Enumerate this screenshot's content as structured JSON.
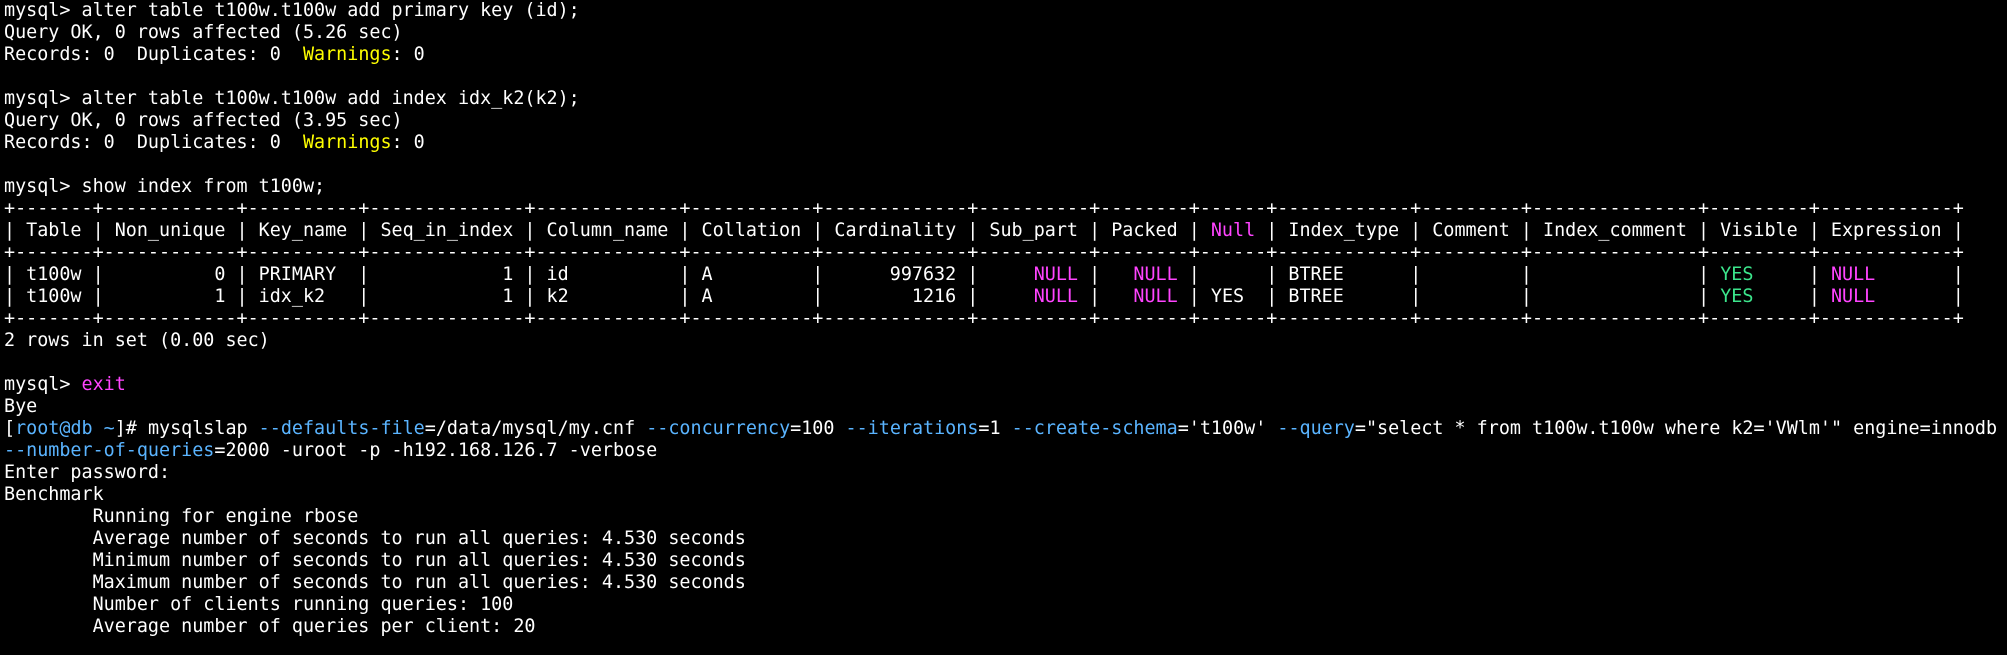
{
  "colors": {
    "background": "#000000",
    "text": "#ffffff",
    "yellow": "#ffff00",
    "magenta": "#ff44ff",
    "green": "#3ce68c",
    "cyan": "#5ab4ff"
  },
  "lines": [
    [
      {
        "t": "mysql> alter table t100w.t100w add primary key (id);"
      }
    ],
    [
      {
        "t": "Query OK, 0 rows affected (5.26 sec)"
      }
    ],
    [
      {
        "t": "Records: 0  Duplicates: 0  "
      },
      {
        "t": "Warnings",
        "c": "yellow"
      },
      {
        "t": ": 0"
      }
    ],
    [
      {
        "t": ""
      }
    ],
    [
      {
        "t": "mysql> alter table t100w.t100w add index idx_k2(k2);"
      }
    ],
    [
      {
        "t": "Query OK, 0 rows affected (3.95 sec)"
      }
    ],
    [
      {
        "t": "Records: 0  Duplicates: 0  "
      },
      {
        "t": "Warnings",
        "c": "yellow"
      },
      {
        "t": ": 0"
      }
    ],
    [
      {
        "t": ""
      }
    ],
    [
      {
        "t": "mysql> show index from t100w;"
      }
    ],
    [
      {
        "t": "+-------+------------+----------+--------------+-------------+-----------+-------------+----------+--------+------+------------+---------+---------------+---------+------------+"
      }
    ],
    [
      {
        "t": "| Table | Non_unique | Key_name | Seq_in_index | Column_name | Collation | Cardinality | Sub_part | Packed | "
      },
      {
        "t": "Null",
        "c": "magenta"
      },
      {
        "t": " | Index_type | Comment | Index_comment | Visible | Expression |"
      }
    ],
    [
      {
        "t": "+-------+------------+----------+--------------+-------------+-----------+-------------+----------+--------+------+------------+---------+---------------+---------+------------+"
      }
    ],
    [
      {
        "t": "| t100w |          0 | PRIMARY  |            1 | id          | A         |      997632 |     "
      },
      {
        "t": "NULL",
        "c": "magenta"
      },
      {
        "t": " |   "
      },
      {
        "t": "NULL",
        "c": "magenta"
      },
      {
        "t": " |      | BTREE      |         |               | "
      },
      {
        "t": "YES",
        "c": "green"
      },
      {
        "t": "     | "
      },
      {
        "t": "NULL",
        "c": "magenta"
      },
      {
        "t": "       |"
      }
    ],
    [
      {
        "t": "| t100w |          1 | idx_k2   |            1 | k2          | A         |        1216 |     "
      },
      {
        "t": "NULL",
        "c": "magenta"
      },
      {
        "t": " |   "
      },
      {
        "t": "NULL",
        "c": "magenta"
      },
      {
        "t": " | YES  | BTREE      |         |               | "
      },
      {
        "t": "YES",
        "c": "green"
      },
      {
        "t": "     | "
      },
      {
        "t": "NULL",
        "c": "magenta"
      },
      {
        "t": "       |"
      }
    ],
    [
      {
        "t": "+-------+------------+----------+--------------+-------------+-----------+-------------+----------+--------+------+------------+---------+---------------+---------+------------+"
      }
    ],
    [
      {
        "t": "2 rows in set (0.00 sec)"
      }
    ],
    [
      {
        "t": ""
      }
    ],
    [
      {
        "t": "mysql> "
      },
      {
        "t": "exit",
        "c": "magenta"
      }
    ],
    [
      {
        "t": "Bye"
      }
    ],
    [
      {
        "t": "["
      },
      {
        "t": "root@db ~",
        "c": "cyan"
      },
      {
        "t": "]# mysqlslap "
      },
      {
        "t": "--defaults-file",
        "c": "cyan"
      },
      {
        "t": "=/data/mysql/my.cnf "
      },
      {
        "t": "--concurrency",
        "c": "cyan"
      },
      {
        "t": "=100 "
      },
      {
        "t": "--iterations",
        "c": "cyan"
      },
      {
        "t": "=1 "
      },
      {
        "t": "--create-schema",
        "c": "cyan"
      },
      {
        "t": "='t100w' "
      },
      {
        "t": "--query",
        "c": "cyan"
      },
      {
        "t": "=\"select * from t100w.t100w where k2='VWlm'\" engine=innodb"
      }
    ],
    [
      {
        "t": "--number-of-queries",
        "c": "cyan"
      },
      {
        "t": "=2000 -uroot -p -h192.168.126.7 -verbose"
      }
    ],
    [
      {
        "t": "Enter password:"
      }
    ],
    [
      {
        "t": "Benchmark"
      }
    ],
    [
      {
        "t": "        Running for engine rbose"
      }
    ],
    [
      {
        "t": "        Average number of seconds to run all queries: 4.530 seconds"
      }
    ],
    [
      {
        "t": "        Minimum number of seconds to run all queries: 4.530 seconds"
      }
    ],
    [
      {
        "t": "        Maximum number of seconds to run all queries: 4.530 seconds"
      }
    ],
    [
      {
        "t": "        Number of clients running queries: 100"
      }
    ],
    [
      {
        "t": "        Average number of queries per client: 20"
      }
    ]
  ]
}
